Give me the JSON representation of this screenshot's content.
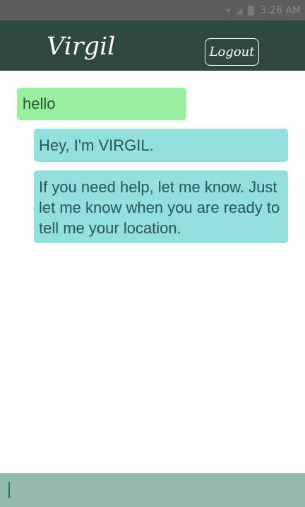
{
  "status_bar": {
    "time": "3:26 AM",
    "icons": [
      "wifi-icon",
      "signal-icon",
      "battery-icon"
    ]
  },
  "header": {
    "title": "Virgil",
    "logout_label": "Logout"
  },
  "messages": [
    {
      "sender": "user",
      "text": "hello"
    },
    {
      "sender": "bot",
      "text": "Hey, I'm VIRGIL."
    },
    {
      "sender": "bot",
      "text": "If you need help, let me know. Just let me know when you are ready to tell me your location."
    }
  ],
  "input": {
    "value": "",
    "placeholder": ""
  },
  "colors": {
    "header_bg": "#2e4a3f",
    "user_bubble": "#98ee9f",
    "bot_bubble": "#92dfe0",
    "input_bar": "#96b9ad"
  }
}
